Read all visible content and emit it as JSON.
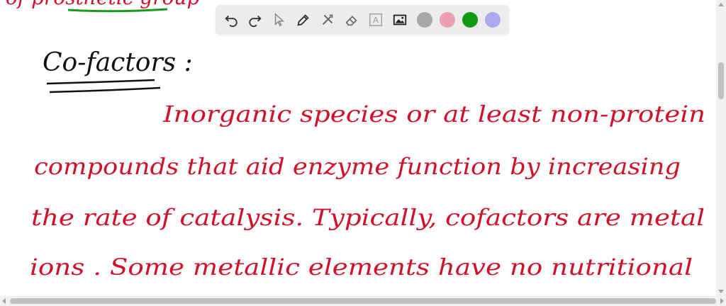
{
  "toolbar": {
    "tools": [
      "undo-icon",
      "redo-icon",
      "pointer-icon",
      "pen-icon",
      "tools-icon",
      "eraser-icon",
      "text-tool-icon",
      "image-icon"
    ],
    "text_tool_glyph": "A",
    "colors": [
      "#a8a8a8",
      "#eaa1ad",
      "#119a11",
      "#aaaaee"
    ],
    "selected_color": "#119a11"
  },
  "canvas": {
    "top_fragment": "of prosthetic group",
    "heading": "Co-factors :",
    "lines": [
      "Inorganic species or at least non-protein",
      "compounds that aid enzyme function by increasing",
      "the rate of catalysis. Typically, cofactors are metal",
      "ions . Some metallic elements have no nutritional"
    ],
    "ink_colors": {
      "heading": "#111111",
      "body": "#d1102a",
      "underline_green": "#1a9a1a"
    }
  }
}
